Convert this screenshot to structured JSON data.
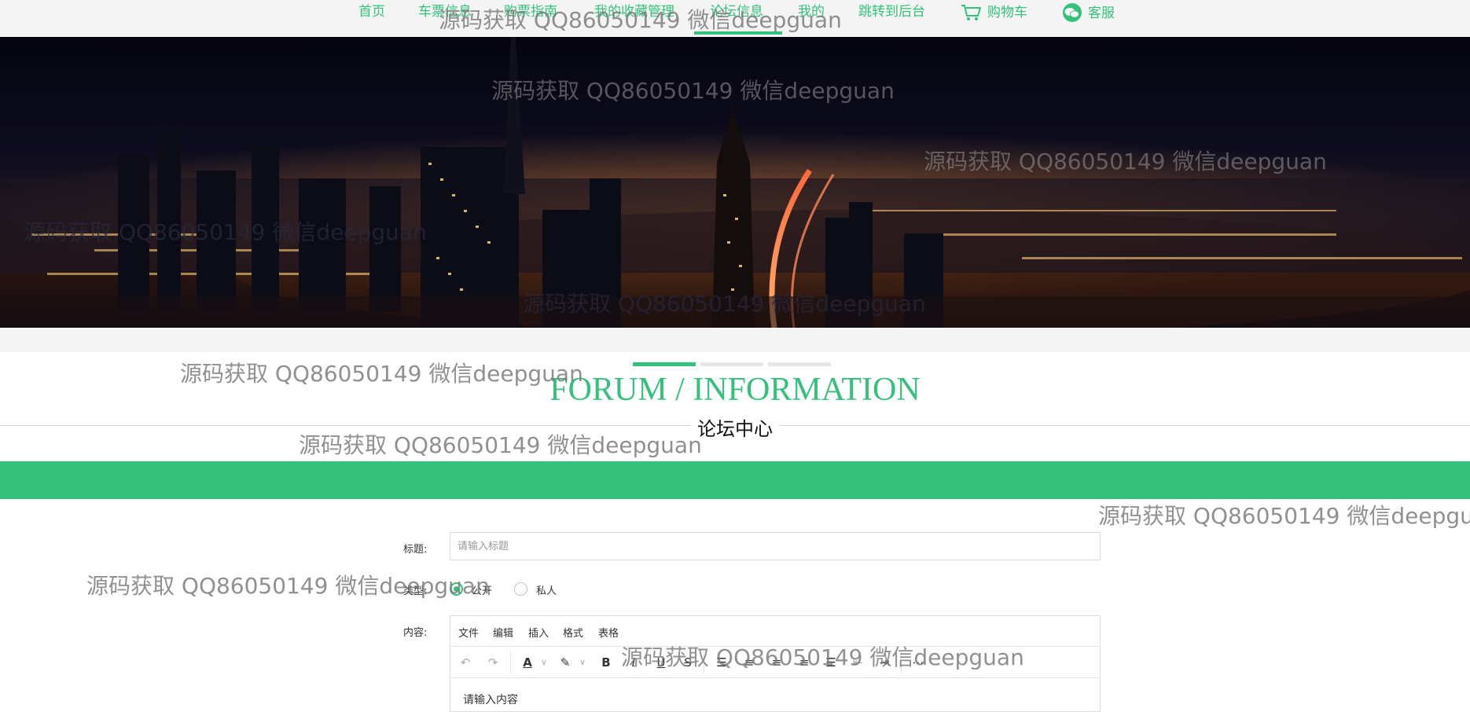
{
  "nav": {
    "items": [
      {
        "label": "首页"
      },
      {
        "label": "车票信息"
      },
      {
        "label": "购票指南"
      },
      {
        "label": "我的收藏管理"
      },
      {
        "label": "论坛信息"
      },
      {
        "label": "我的"
      },
      {
        "label": "跳转到后台"
      },
      {
        "label": "购物车"
      },
      {
        "label": "客服"
      }
    ],
    "active_index": 4
  },
  "section": {
    "title": "FORUM / INFORMATION",
    "subtitle": "论坛中心"
  },
  "form": {
    "title_label": "标题:",
    "title_placeholder": "请输入标题",
    "type_label": "类型:",
    "type_options": [
      {
        "label": "公开",
        "checked": true
      },
      {
        "label": "私人",
        "checked": false
      }
    ],
    "content_label": "内容:",
    "editor_menu": [
      "文件",
      "编辑",
      "插入",
      "格式",
      "表格"
    ],
    "toolbar_icons": [
      "undo-icon",
      "redo-icon",
      "font-color-icon",
      "highlight-icon",
      "bold-icon",
      "italic-icon",
      "underline-icon",
      "strikethrough-icon",
      "bullet-list-icon",
      "align-left-icon",
      "align-center-icon",
      "align-right-icon",
      "align-justify-icon",
      "outdent-icon",
      "indent-icon",
      "more-icon"
    ],
    "content_placeholder": "请输入内容"
  },
  "watermark": "源码获取 QQ86050149 微信deepguan",
  "colors": {
    "accent": "#35c17b",
    "nav_bg": "#f4f4f4"
  }
}
